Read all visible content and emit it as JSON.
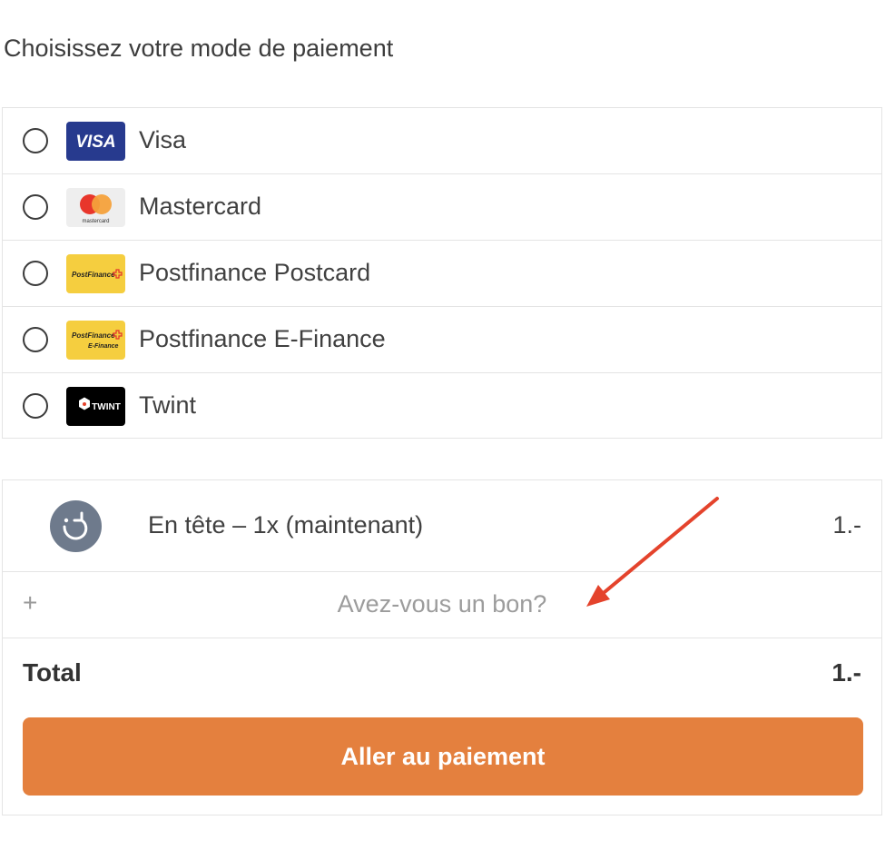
{
  "page_title": "Choisissez votre mode de paiement",
  "payment_methods": [
    {
      "label": "Visa",
      "logo_text": "VISA",
      "icon": "visa-logo"
    },
    {
      "label": "Mastercard",
      "logo_text": "mastercard",
      "icon": "mastercard-logo"
    },
    {
      "label": "Postfinance Postcard",
      "logo_text": "PostFinance",
      "icon": "postfinance-logo"
    },
    {
      "label": "Postfinance E-Finance",
      "logo_text": "PostFinance",
      "logo_subtext": "E-Finance",
      "icon": "postfinance-efinance-logo"
    },
    {
      "label": "Twint",
      "logo_text": "TWINT",
      "icon": "twint-logo"
    }
  ],
  "order": {
    "item_label": "En tête – 1x (maintenant)",
    "item_price": "1.-",
    "item_icon": "boost-arrow-icon",
    "voucher_plus": "+",
    "voucher_text": "Avez-vous un bon?",
    "total_label": "Total",
    "total_value": "1.-",
    "pay_button": "Aller au paiement"
  },
  "colors": {
    "accent": "#e4803e",
    "visa": "#273a8e",
    "postfinance": "#f5ce3f",
    "annotation_arrow": "#e4432c"
  }
}
